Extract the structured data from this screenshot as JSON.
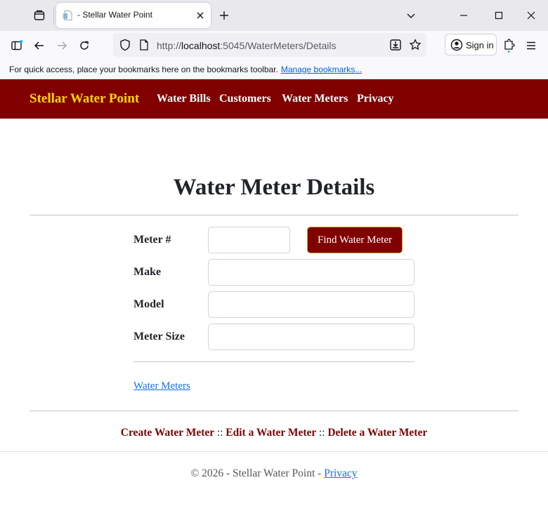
{
  "browser": {
    "tab_title": "- Stellar Water Point",
    "url_prefix": "http://",
    "url_host": "localhost",
    "url_rest": ":5045/WaterMeters/Details",
    "sign_in_label": "Sign in",
    "bookmarks_message": "For quick access, place your bookmarks here on the bookmarks toolbar.",
    "bookmarks_link": "Manage bookmarks..."
  },
  "site": {
    "brand": "Stellar Water Point",
    "nav": [
      "Water Bills",
      "Customers",
      "Water Meters",
      "Privacy"
    ]
  },
  "main": {
    "title": "Water Meter Details",
    "fields": {
      "meter_number": {
        "label": "Meter #",
        "value": ""
      },
      "make": {
        "label": "Make",
        "value": ""
      },
      "model": {
        "label": "Model",
        "value": ""
      },
      "meter_size": {
        "label": "Meter Size",
        "value": ""
      }
    },
    "find_button": "Find Water Meter",
    "back_link": "Water Meters"
  },
  "actions": {
    "create": "Create Water Meter",
    "edit": "Edit a Water Meter",
    "delete": "Delete a Water Meter",
    "separator": "::"
  },
  "footer": {
    "text": "© 2026 - Stellar Water Point - ",
    "privacy_link": "Privacy"
  },
  "colors": {
    "brand_bar": "#800000",
    "brand_text": "#ffd700",
    "link": "#0d6efd"
  }
}
